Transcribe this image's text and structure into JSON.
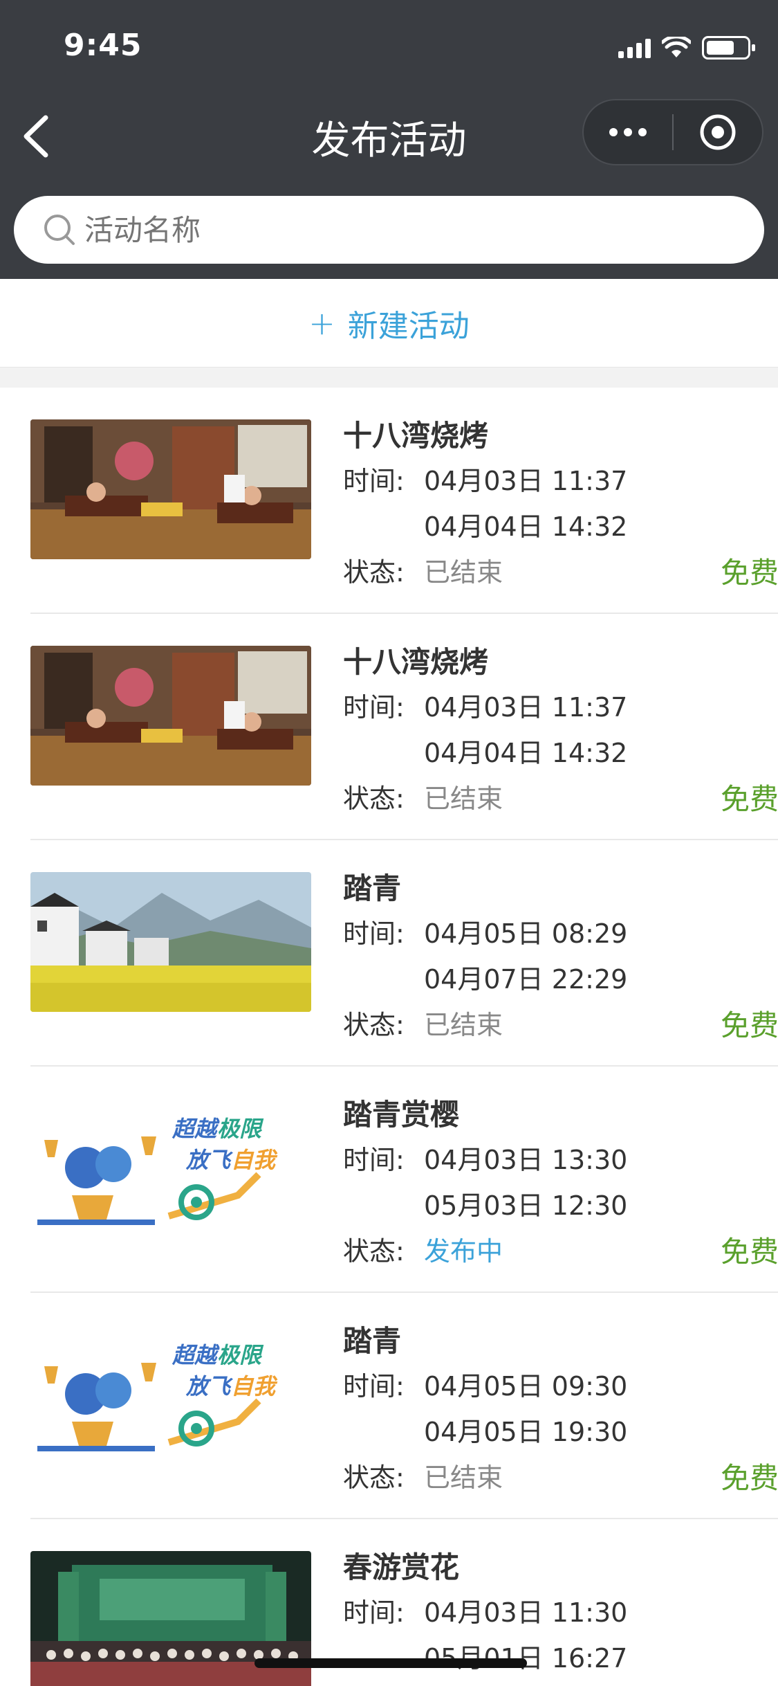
{
  "status_bar": {
    "time": "9:45"
  },
  "nav": {
    "title": "发布活动"
  },
  "search": {
    "placeholder": "活动名称"
  },
  "new_activity": {
    "plus": "+",
    "label": "新建活动"
  },
  "labels": {
    "time": "时间:",
    "status": "状态:"
  },
  "colors": {
    "header_bg": "#3a3d42",
    "accent_blue": "#3ba2d9",
    "fee_green": "#5aa02c"
  },
  "activities": [
    {
      "title": "十八湾烧烤",
      "start": "04月03日 11:37",
      "end": "04月04日 14:32",
      "status": "已结束",
      "fee": "免费",
      "thumb": "classroom-photo"
    },
    {
      "title": "十八湾烧烤",
      "start": "04月03日 11:37",
      "end": "04月04日 14:32",
      "status": "已结束",
      "fee": "免费",
      "thumb": "classroom-photo"
    },
    {
      "title": "踏青",
      "start": "04月05日 08:29",
      "end": "04月07日 22:29",
      "status": "已结束",
      "fee": "免费",
      "thumb": "village-landscape"
    },
    {
      "title": "踏青赏樱",
      "start": "04月03日 13:30",
      "end": "05月03日 12:30",
      "status": "发布中",
      "fee": "免费",
      "thumb": "poster-illustration"
    },
    {
      "title": "踏青",
      "start": "04月05日 09:30",
      "end": "04月05日 19:30",
      "status": "已结束",
      "fee": "免费",
      "thumb": "poster-illustration"
    },
    {
      "title": "春游赏花",
      "start": "04月03日 11:30",
      "end": "05月01日 16:27",
      "status": "",
      "fee": "",
      "thumb": "stage-group-photo"
    }
  ],
  "poster_text": {
    "line1a": "超越",
    "line1b": "极限",
    "line2a": "放飞",
    "line2b": "自我"
  }
}
